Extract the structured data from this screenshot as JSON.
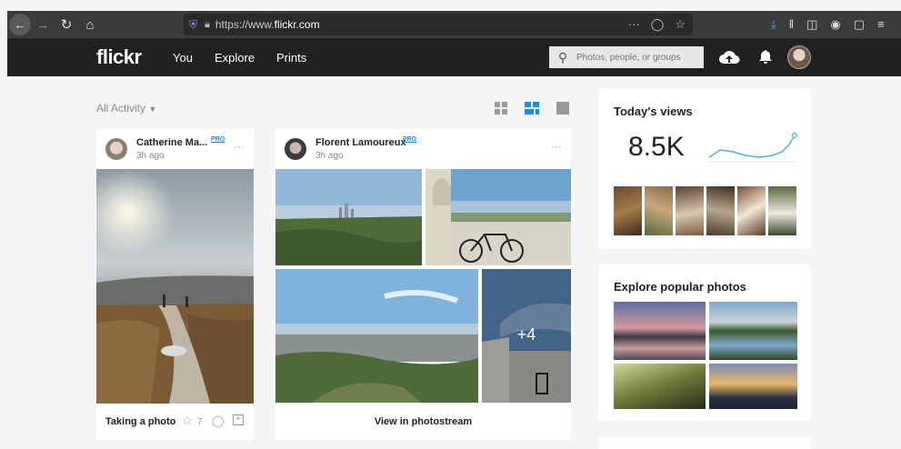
{
  "browser": {
    "url_prefix": "https://www.",
    "url_domain": "flickr.com",
    "more": "···"
  },
  "nav": {
    "logo": "flickr",
    "links": [
      "You",
      "Explore",
      "Prints"
    ],
    "search_placeholder": "Photos, people, or groups"
  },
  "feed": {
    "filter_label": "All Activity",
    "views": [
      "small-grid-icon",
      "medium-grid-icon",
      "single-icon"
    ]
  },
  "posts": [
    {
      "author": "Catherine Ma...",
      "badge": "PRO",
      "time": "3h ago",
      "caption": "Taking a photo",
      "favorites": "7"
    },
    {
      "author": "Florent Lamoureux",
      "badge": "PRO",
      "time": "3h ago",
      "more_count": "+4",
      "footer": "View in photostream"
    }
  ],
  "sidebar": {
    "views_title": "Today's views",
    "views_count": "8.5K",
    "explore_title": "Explore popular photos"
  },
  "colors": {
    "nav_bg": "#212124",
    "accent": "#1d8de0",
    "sparkline": "#4fb0e8"
  }
}
